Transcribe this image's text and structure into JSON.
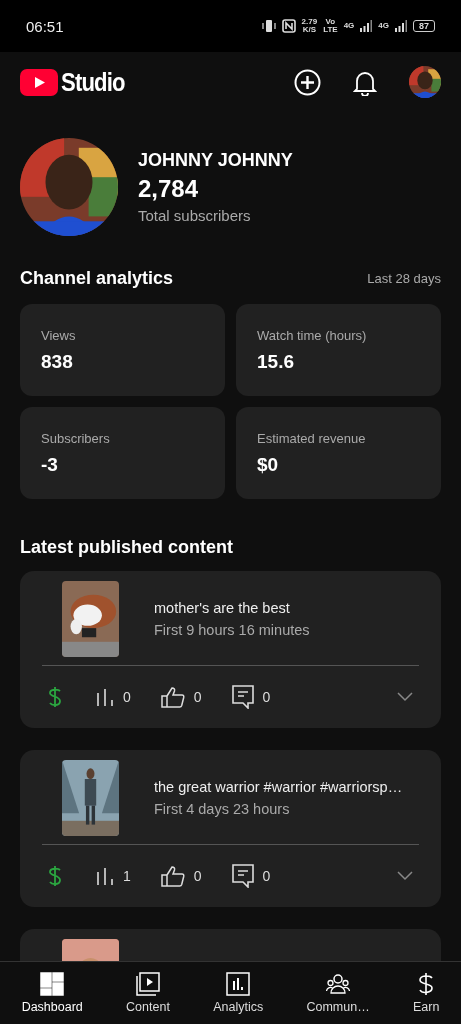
{
  "status_bar": {
    "time": "06:51",
    "speed": "2.79",
    "speed_unit": "K/S",
    "volte": [
      "Vo",
      "LTE"
    ],
    "networks": [
      "4G",
      "4G"
    ],
    "battery": "87"
  },
  "header": {
    "logo": "Studio"
  },
  "channel": {
    "name": "JOHNNY JOHNNY",
    "subscribers": "2,784",
    "subscribers_label": "Total subscribers"
  },
  "analytics": {
    "title": "Channel analytics",
    "period": "Last 28 days",
    "metrics": [
      {
        "label": "Views",
        "value": "838"
      },
      {
        "label": "Watch time (hours)",
        "value": "15.6"
      },
      {
        "label": "Subscribers",
        "value": "-3"
      },
      {
        "label": "Estimated revenue",
        "value": "$0"
      }
    ]
  },
  "latest": {
    "title": "Latest published content",
    "items": [
      {
        "title": "mother's are the best",
        "subtitle": "First 9 hours 16 minutes",
        "views": "0",
        "likes": "0",
        "comments": "0",
        "monetized": true
      },
      {
        "title": "the great warrior #warrior #warriorsp…",
        "subtitle": "First 4 days 23 hours",
        "views": "1",
        "likes": "0",
        "comments": "0",
        "monetized": true
      }
    ]
  },
  "bottom_nav": [
    {
      "label": "Dashboard",
      "kind": "dashboard",
      "selected": true
    },
    {
      "label": "Content",
      "kind": "content",
      "selected": false
    },
    {
      "label": "Analytics",
      "kind": "analytics",
      "selected": false
    },
    {
      "label": "Commun…",
      "kind": "community",
      "selected": false
    },
    {
      "label": "Earn",
      "kind": "earn",
      "selected": false
    }
  ]
}
